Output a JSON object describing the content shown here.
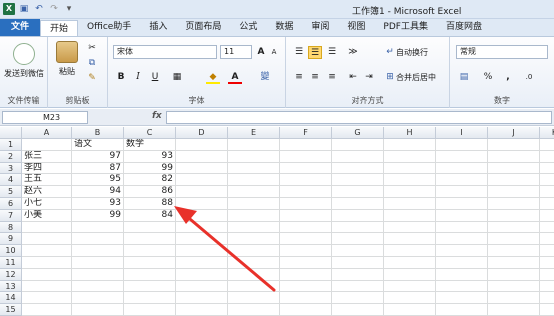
{
  "window": {
    "title": "工作簿1 - Microsoft Excel",
    "logo": "X"
  },
  "qat": [
    "save-icon",
    "undo-icon",
    "redo-icon",
    "customize-icon"
  ],
  "menu": {
    "file": "文件",
    "tabs": [
      "开始",
      "Office助手",
      "插入",
      "页面布局",
      "公式",
      "数据",
      "审阅",
      "视图",
      "PDF工具集",
      "百度网盘"
    ],
    "active": "开始"
  },
  "ribbon": {
    "wechat": {
      "label": "发送到微信",
      "group": "文件传输"
    },
    "clipboard": {
      "paste": "粘贴",
      "group": "剪贴板"
    },
    "font": {
      "name": "宋体",
      "size": "11",
      "grow": "A",
      "shrink": "A",
      "bold": "B",
      "italic": "I",
      "underline": "U",
      "fontcolor": "A",
      "phonetic": "變",
      "group": "字体"
    },
    "align": {
      "wrap": "自动换行",
      "merge": "合并后居中",
      "group": "对齐方式"
    },
    "number": {
      "format": "常规",
      "percent": "%",
      "comma": ",",
      "group": "数字"
    }
  },
  "formula_bar": {
    "name_box": "M23",
    "fx": "fx",
    "value": ""
  },
  "sheet": {
    "columns": [
      "A",
      "B",
      "C",
      "D",
      "E",
      "F",
      "G",
      "H",
      "I",
      "J",
      "K"
    ],
    "rows": [
      "1",
      "2",
      "3",
      "4",
      "5",
      "6",
      "7",
      "8",
      "9",
      "10",
      "11",
      "12",
      "13",
      "14",
      "15"
    ],
    "cells": [
      [
        "",
        "语文",
        "数学"
      ],
      [
        "张三",
        "97",
        "93"
      ],
      [
        "李四",
        "87",
        "99"
      ],
      [
        "王五",
        "95",
        "82"
      ],
      [
        "赵六",
        "94",
        "86"
      ],
      [
        "小七",
        "93",
        "88"
      ],
      [
        "小美",
        "99",
        "84"
      ]
    ]
  },
  "colors": {
    "accent": "#2a6fbf",
    "arrow": "#e8312a",
    "excel_green": "#1f7244"
  }
}
